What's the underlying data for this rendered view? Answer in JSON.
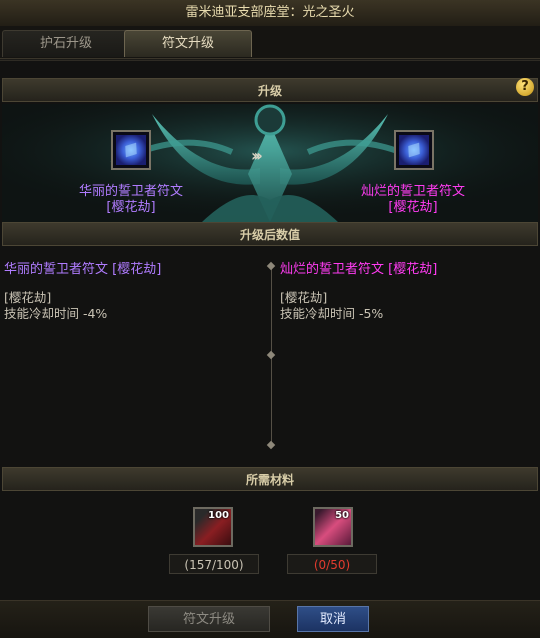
{
  "window": {
    "title": "雷米迪亚支部座堂：光之圣火"
  },
  "tabs": [
    {
      "label": "护石升级",
      "active": false
    },
    {
      "label": "符文升级",
      "active": true
    }
  ],
  "upgrade_section": {
    "header": "升级",
    "help_icon": "?",
    "arrows": "›››",
    "source_rune": {
      "name_line1": "华丽的誓卫者符文",
      "name_line2": "[樱花劫]",
      "color": "#b07cff"
    },
    "target_rune": {
      "name_line1": "灿烂的誓卫者符文",
      "name_line2": "[樱花劫]",
      "color": "#ff3cf2"
    }
  },
  "stats_section": {
    "header": "升级后数值",
    "left": {
      "name": "华丽的誓卫者符文 [樱花劫]",
      "tag": "[樱花劫]",
      "effect": "技能冷却时间 -4%"
    },
    "right": {
      "name": "灿烂的誓卫者符文 [樱花劫]",
      "tag": "[樱花劫]",
      "effect": "技能冷却时间 -5%"
    }
  },
  "materials_section": {
    "header": "所需材料",
    "items": [
      {
        "stack": "100",
        "qty": "(157/100)",
        "qty_color": "#c9c3b4",
        "icon": "red-material-icon"
      },
      {
        "stack": "50",
        "qty": "(0/50)",
        "qty_color": "#e23b2e",
        "icon": "pink-crystal-icon"
      }
    ]
  },
  "buttons": {
    "upgrade": "符文升级",
    "cancel": "取消"
  }
}
